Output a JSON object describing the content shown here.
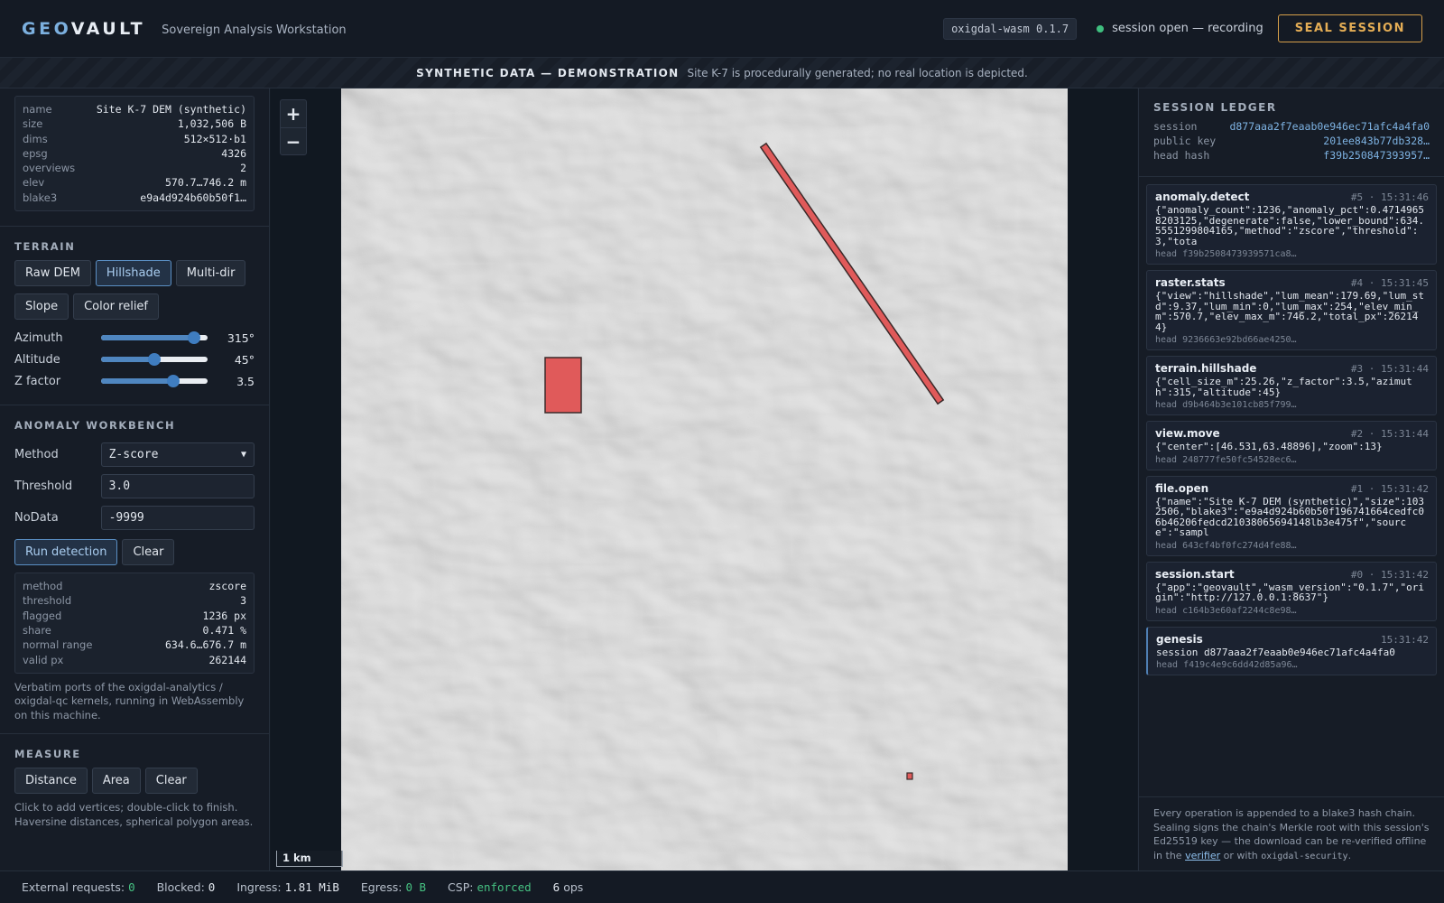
{
  "header": {
    "logo_accent": "GEO",
    "logo_rest": "VAULT",
    "subtitle": "Sovereign Analysis Workstation",
    "version": "oxigdal-wasm 0.1.7",
    "status": "session open — recording",
    "seal_label": "SEAL SESSION"
  },
  "banner": {
    "title": "SYNTHETIC DATA — DEMONSTRATION",
    "text": "Site K-7 is procedurally generated; no real location is depicted."
  },
  "file_meta": [
    {
      "k": "name",
      "v": "Site K-7 DEM (synthetic)"
    },
    {
      "k": "size",
      "v": "1,032,506 B"
    },
    {
      "k": "dims",
      "v": "512×512·b1"
    },
    {
      "k": "epsg",
      "v": "4326"
    },
    {
      "k": "overviews",
      "v": "2"
    },
    {
      "k": "elev",
      "v": "570.7…746.2 m"
    },
    {
      "k": "blake3",
      "v": "e9a4d924b60b50f1…"
    }
  ],
  "terrain": {
    "title": "TERRAIN",
    "modes": [
      "Raw DEM",
      "Hillshade",
      "Multi-dir",
      "Slope",
      "Color relief"
    ],
    "active_mode": "Hillshade",
    "sliders": [
      {
        "label": "Azimuth",
        "value": "315°",
        "fraction": 0.875
      },
      {
        "label": "Altitude",
        "value": "45°",
        "fraction": 0.5
      },
      {
        "label": "Z factor",
        "value": "3.5",
        "fraction": 0.68
      }
    ]
  },
  "anomaly": {
    "title": "ANOMALY WORKBENCH",
    "method_label": "Method",
    "method_value": "Z-score",
    "threshold_label": "Threshold",
    "threshold_value": "3.0",
    "nodata_label": "NoData",
    "nodata_value": "-9999",
    "run_label": "Run detection",
    "clear_label": "Clear",
    "results": [
      {
        "k": "method",
        "v": "zscore"
      },
      {
        "k": "threshold",
        "v": "3"
      },
      {
        "k": "flagged",
        "v": "1236 px"
      },
      {
        "k": "share",
        "v": "0.471 %"
      },
      {
        "k": "normal range",
        "v": "634.6…676.7 m"
      },
      {
        "k": "valid px",
        "v": "262144"
      }
    ],
    "note": "Verbatim ports of the oxigdal-analytics / oxigdal-qc kernels, running in WebAssembly on this machine."
  },
  "measure": {
    "title": "MEASURE",
    "distance_label": "Distance",
    "area_label": "Area",
    "clear_label": "Clear",
    "note": "Click to add vertices; double-click to finish. Haversine distances, spherical polygon areas."
  },
  "map": {
    "zoom_in": "+",
    "zoom_out": "−",
    "scale_label": "1 km",
    "anomaly_color": "#e05a5a"
  },
  "ledger": {
    "title": "SESSION LEDGER",
    "session_label": "session",
    "session_value": "d877aaa2f7eaab0e946ec71afc4a4fa0",
    "pubkey_label": "public key",
    "pubkey_value": "201ee843b77db328…",
    "headhash_label": "head hash",
    "headhash_value": "f39b250847393957…",
    "entries": [
      {
        "name": "anomaly.detect",
        "meta": "#5 · 15:31:46",
        "body": "{\"anomaly_count\":1236,\"anomaly_pct\":0.47149658203125,\"degenerate\":false,\"lower_bound\":634.5551299804165,\"method\":\"zscore\",\"threshold\":3,\"tota",
        "head": "head f39b2508473939571ca8…"
      },
      {
        "name": "raster.stats",
        "meta": "#4 · 15:31:45",
        "body": "{\"view\":\"hillshade\",\"lum_mean\":179.69,\"lum_std\":9.37,\"lum_min\":0,\"lum_max\":254,\"elev_min_m\":570.7,\"elev_max_m\":746.2,\"total_px\":262144}",
        "head": "head 9236663e92bd66ae4250…"
      },
      {
        "name": "terrain.hillshade",
        "meta": "#3 · 15:31:44",
        "body": "{\"cell_size_m\":25.26,\"z_factor\":3.5,\"azimuth\":315,\"altitude\":45}",
        "head": "head d9b464b3e101cb85f799…"
      },
      {
        "name": "view.move",
        "meta": "#2 · 15:31:44",
        "body": "{\"center\":[46.531,63.48896],\"zoom\":13}",
        "head": "head 248777fe50fc54528ec6…"
      },
      {
        "name": "file.open",
        "meta": "#1 · 15:31:42",
        "body": "{\"name\":\"Site K-7 DEM (synthetic)\",\"size\":1032506,\"blake3\":\"e9a4d924b60b50f196741664cedfc06b46206fedcd21038065694148lb3e475f\",\"source\":\"sampl",
        "head": "head 643cf4bf0fc274d4fe88…"
      },
      {
        "name": "session.start",
        "meta": "#0 · 15:31:42",
        "body": "{\"app\":\"geovault\",\"wasm_version\":\"0.1.7\",\"origin\":\"http://127.0.0.1:8637\"}",
        "head": "head c164b3e60af2244c8e98…"
      },
      {
        "name": "genesis",
        "meta": "15:31:42",
        "body": "session d877aaa2f7eaab0e946ec71afc4a4fa0",
        "head": "head f419c4e9c6dd42d85a96…"
      }
    ],
    "foot_text_1": "Every operation is appended to a blake3 hash chain. Sealing signs the chain's Merkle root with this session's Ed25519 key — the download can be re-verified offline in the",
    "foot_link": "verifier",
    "foot_text_2": "or with",
    "foot_code": "oxigdal-security",
    "foot_end": "."
  },
  "footer": {
    "ext_label": "External requests:",
    "ext_value": "0",
    "blocked_label": "Blocked:",
    "blocked_value": "0",
    "ingress_label": "Ingress:",
    "ingress_value": "1.81 MiB",
    "egress_label": "Egress:",
    "egress_value": "0 B",
    "csp_label": "CSP:",
    "csp_value": "enforced",
    "ops_count": "6",
    "ops_label": "ops"
  }
}
